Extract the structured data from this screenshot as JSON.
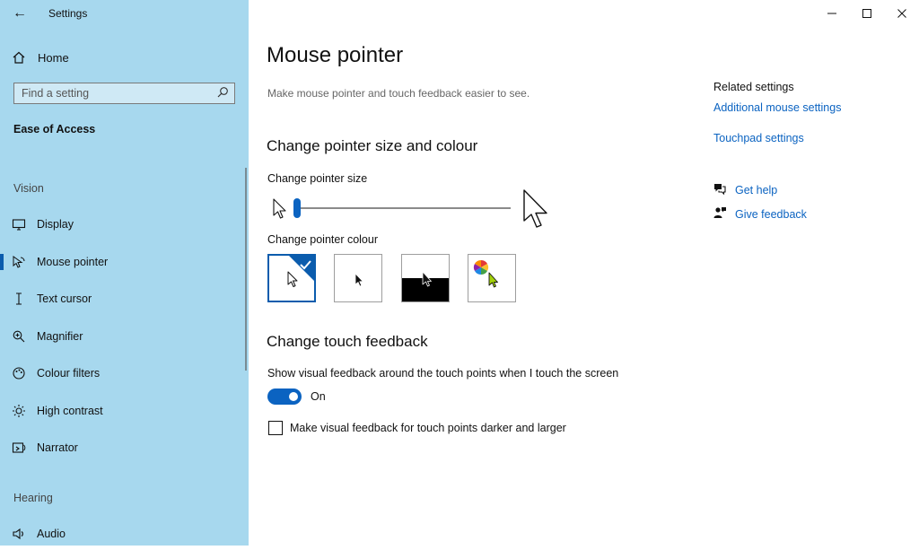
{
  "window": {
    "app_title": "Settings"
  },
  "sidebar": {
    "home_label": "Home",
    "search_placeholder": "Find a setting",
    "section_title": "Ease of Access",
    "groups": {
      "vision": "Vision",
      "hearing": "Hearing"
    },
    "items": [
      {
        "label": "Display",
        "icon": "monitor-icon"
      },
      {
        "label": "Mouse pointer",
        "icon": "mouse-pointer-icon",
        "active": true
      },
      {
        "label": "Text cursor",
        "icon": "text-cursor-icon"
      },
      {
        "label": "Magnifier",
        "icon": "magnifier-icon"
      },
      {
        "label": "Colour filters",
        "icon": "colour-filters-icon"
      },
      {
        "label": "High contrast",
        "icon": "high-contrast-icon"
      },
      {
        "label": "Narrator",
        "icon": "narrator-icon"
      },
      {
        "label": "Audio",
        "icon": "audio-icon"
      }
    ]
  },
  "main": {
    "title": "Mouse pointer",
    "subtitle": "Make mouse pointer and touch feedback easier to see.",
    "pointer_section": {
      "heading": "Change pointer size and colour",
      "size_label": "Change pointer size",
      "size_value": 1,
      "colour_label": "Change pointer colour",
      "colour_options": [
        "white",
        "black",
        "inverted",
        "custom"
      ],
      "selected_colour": "white"
    },
    "touch_section": {
      "heading": "Change touch feedback",
      "toggle_label": "Show visual feedback around the touch points when I touch the screen",
      "toggle_state": "On",
      "checkbox_label": "Make visual feedback for touch points darker and larger",
      "checkbox_checked": false
    }
  },
  "related": {
    "heading": "Related settings",
    "links": [
      "Additional mouse settings",
      "Touchpad settings"
    ],
    "get_help": "Get help",
    "give_feedback": "Give feedback"
  },
  "colors": {
    "accent": "#0b63c1",
    "sidebar_bg": "#a7d8ee"
  }
}
